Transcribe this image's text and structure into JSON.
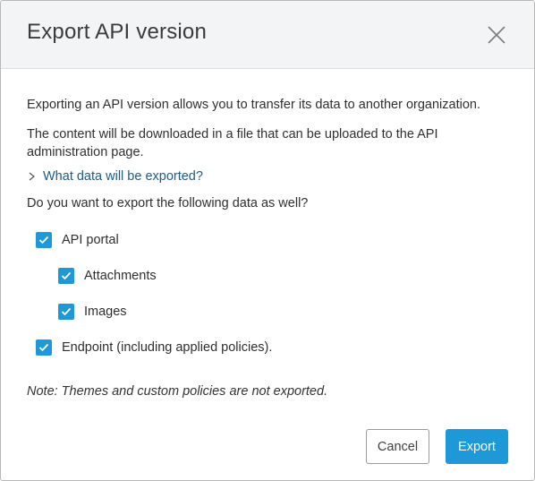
{
  "dialog": {
    "title": "Export API version",
    "intro": "Exporting an API version allows you to transfer its data to another organization.",
    "download_note": "The content will be downloaded in a file that can be uploaded to the API administration page.",
    "details_toggle": "What data will be exported?",
    "question": "Do you want to export the following data as well?",
    "options": [
      {
        "label": "API portal",
        "checked": true
      },
      {
        "label": "Attachments",
        "checked": true
      },
      {
        "label": "Images",
        "checked": true
      },
      {
        "label": "Endpoint (including applied policies).",
        "checked": true
      }
    ],
    "note": "Note: Themes and custom policies are not exported.",
    "buttons": {
      "cancel": "Cancel",
      "export": "Export"
    }
  },
  "colors": {
    "accent": "#1e98d6",
    "link": "#1c5d86",
    "header_bg": "#f3f4f6"
  },
  "icons": {
    "close": "close-icon",
    "toggle": "chevron-right-icon",
    "check": "check-icon"
  }
}
